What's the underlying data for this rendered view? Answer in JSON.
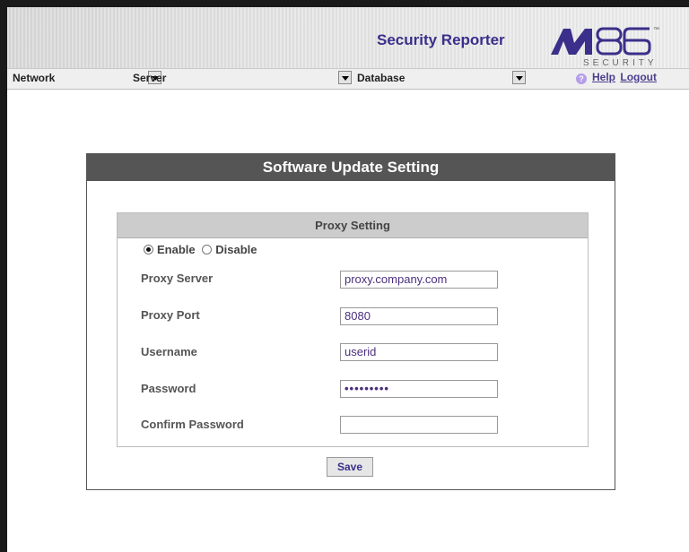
{
  "header": {
    "app_title": "Security Reporter",
    "logo_text": "M86",
    "logo_sub": "SECURITY",
    "logo_tm": "™"
  },
  "menubar": {
    "network": "Network",
    "server": "Server",
    "database": "Database",
    "help": "Help",
    "logout": "Logout"
  },
  "panel": {
    "title": "Software Update Setting",
    "proxy_title": "Proxy Setting",
    "enable_label": "Enable",
    "disable_label": "Disable",
    "proxy_enabled": true,
    "fields": {
      "proxy_server_label": "Proxy Server",
      "proxy_server_value": "proxy.company.com",
      "proxy_port_label": "Proxy Port",
      "proxy_port_value": "8080",
      "username_label": "Username",
      "username_value": "userid",
      "password_label": "Password",
      "password_value": "•••••••••",
      "confirm_password_label": "Confirm Password",
      "confirm_password_value": ""
    },
    "save_label": "Save"
  },
  "colors": {
    "accent": "#3a2f8a",
    "panel_header_bg": "#555555",
    "proxy_header_bg": "#cccccc"
  }
}
